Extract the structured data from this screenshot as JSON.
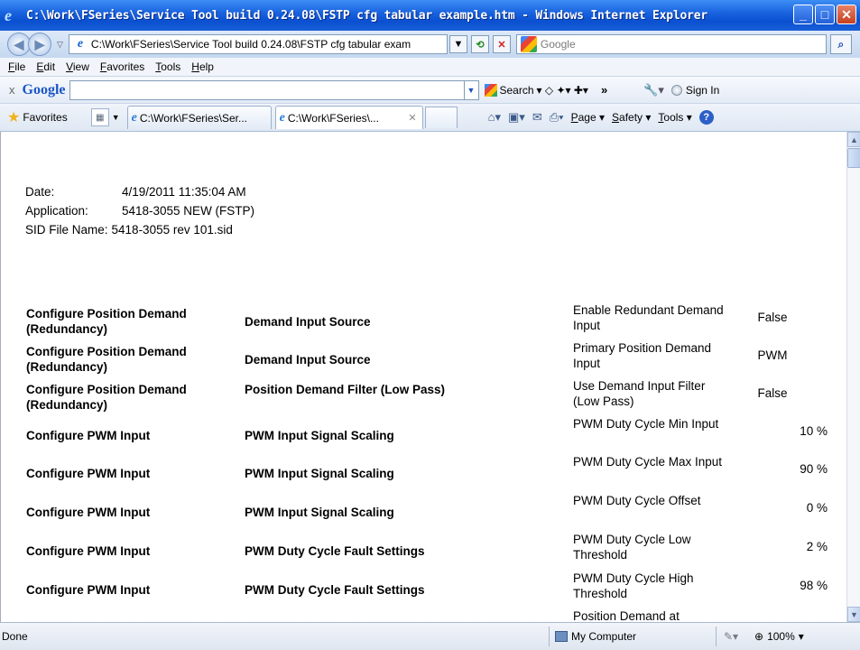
{
  "window": {
    "title": "C:\\Work\\FSeries\\Service Tool build 0.24.08\\FSTP cfg tabular example.htm - Windows Internet Explorer"
  },
  "address": {
    "url": "C:\\Work\\FSeries\\Service Tool build 0.24.08\\FSTP cfg tabular exam",
    "search_placeholder": "Google"
  },
  "menu": [
    "File",
    "Edit",
    "View",
    "Favorites",
    "Tools",
    "Help"
  ],
  "google_toolbar": {
    "close": "x",
    "logo": "Google",
    "search_label": "Search",
    "more": "»",
    "signin": "Sign In"
  },
  "favorites": {
    "label": "Favorites",
    "tabs": [
      {
        "label": "C:\\Work\\FSeries\\Ser..."
      },
      {
        "label": "C:\\Work\\FSeries\\...",
        "close": "✕"
      }
    ],
    "commands": [
      "Page",
      "Safety",
      "Tools"
    ]
  },
  "meta": {
    "date_label": "Date:",
    "date_value": "4/19/2011 11:35:04 AM",
    "app_label": "Application:",
    "app_value": "5418-3055 NEW (FSTP)",
    "sid_label": "SID File Name:",
    "sid_value": "5418-3055 rev 101.sid"
  },
  "rows": [
    {
      "group": "Configure Position Demand (Redundancy)",
      "section": "Demand Input Source",
      "param": "Enable Redundant Demand Input",
      "value": "False"
    },
    {
      "group": "Configure Position Demand (Redundancy)",
      "section": "Demand Input Source",
      "param": "Primary Position Demand Input",
      "value": "PWM"
    },
    {
      "group": "Configure Position Demand (Redundancy)",
      "section": "Position Demand Filter (Low Pass)",
      "param": "Use Demand Input Filter (Low Pass)",
      "value": "False"
    },
    {
      "group": "Configure PWM Input",
      "section": "PWM Input Signal Scaling",
      "param": "PWM Duty Cycle Min Input",
      "value": "10 %"
    },
    {
      "group": "Configure PWM Input",
      "section": "PWM Input Signal Scaling",
      "param": "PWM Duty Cycle Max Input",
      "value": "90 %"
    },
    {
      "group": "Configure PWM Input",
      "section": "PWM Input Signal Scaling",
      "param": "PWM Duty Cycle Offset",
      "value": "0 %"
    },
    {
      "group": "Configure PWM Input",
      "section": "PWM Duty Cycle Fault Settings",
      "param": "PWM Duty Cycle Low Threshold",
      "value": "2 %"
    },
    {
      "group": "Configure PWM Input",
      "section": "PWM Duty Cycle Fault Settings",
      "param": "PWM Duty Cycle High Threshold",
      "value": "98 %"
    },
    {
      "group": "",
      "section": "",
      "param": "Position Demand at",
      "value": ""
    }
  ],
  "status": {
    "text": "Done",
    "zone": "My Computer",
    "zoom": "100%"
  }
}
